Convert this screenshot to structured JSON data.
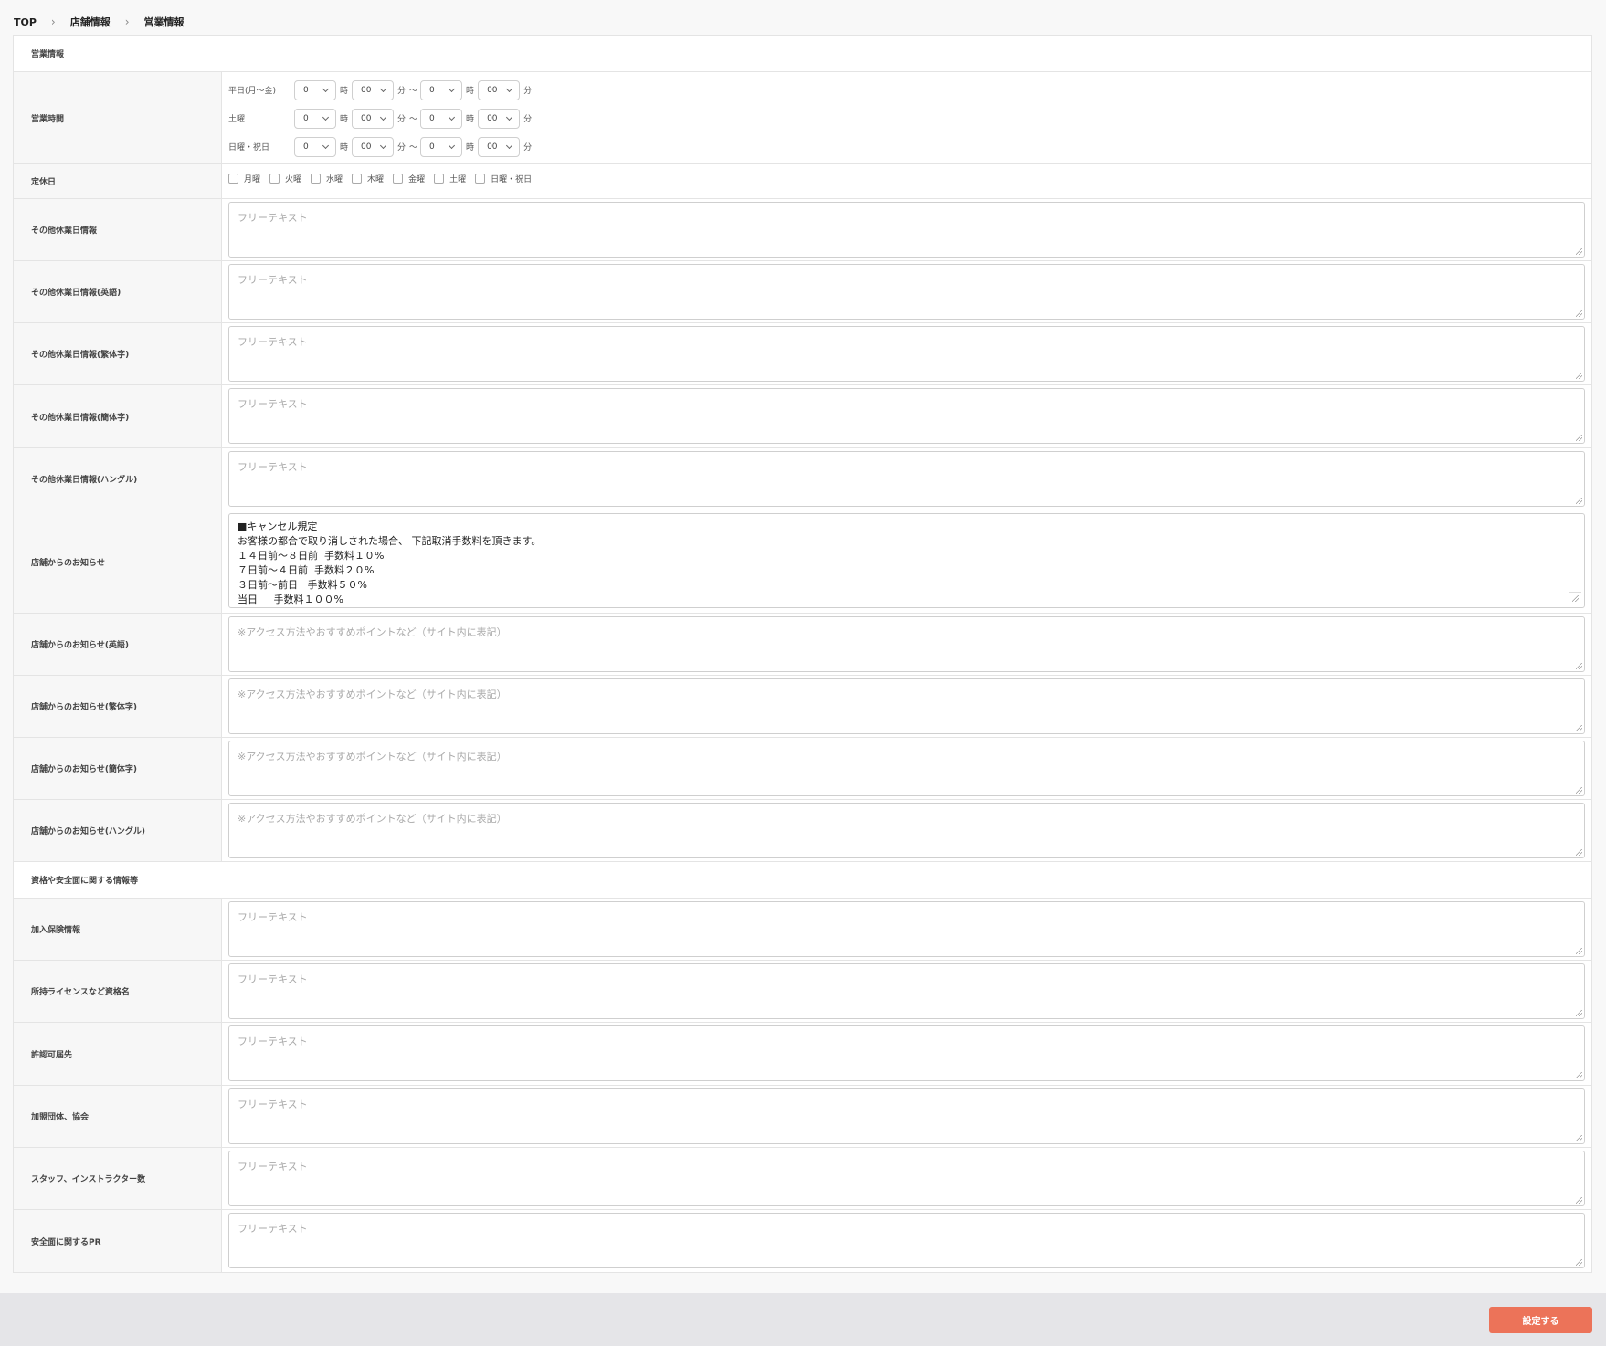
{
  "breadcrumb": [
    "TOP",
    "店舗情報",
    "営業情報"
  ],
  "section1": {
    "title": "営業情報",
    "hours": {
      "label": "営業時間",
      "rows": [
        {
          "day": "平日(月〜金)",
          "sh": "0",
          "sm": "00",
          "eh": "0",
          "em": "00"
        },
        {
          "day": "土曜",
          "sh": "0",
          "sm": "00",
          "eh": "0",
          "em": "00"
        },
        {
          "day": "日曜・祝日",
          "sh": "0",
          "sm": "00",
          "eh": "0",
          "em": "00"
        }
      ],
      "unit_hour": "時",
      "unit_min": "分",
      "tilde": "〜"
    },
    "holidays": {
      "label": "定休日",
      "options": [
        "月曜",
        "火曜",
        "水曜",
        "木曜",
        "金曜",
        "土曜",
        "日曜・祝日"
      ]
    },
    "text_fields": [
      {
        "label": "その他休業日情報",
        "placeholder": "フリーテキスト"
      },
      {
        "label": "その他休業日情報(英語)",
        "placeholder": "フリーテキスト"
      },
      {
        "label": "その他休業日情報(繁体字)",
        "placeholder": "フリーテキスト"
      },
      {
        "label": "その他休業日情報(簡体字)",
        "placeholder": "フリーテキスト"
      },
      {
        "label": "その他休業日情報(ハングル)",
        "placeholder": "フリーテキスト"
      }
    ],
    "notice": {
      "label": "店舗からのお知らせ",
      "lines": [
        "■キャンセル規定",
        "お客様の都合で取り消しされた場合、 下記取消手数料を頂きます。",
        "１４日前〜８日前  手数料１０%",
        "７日前〜４日前  手数料２０%",
        "３日前〜前日   手数料５０%",
        "当日     手数料１００%"
      ]
    },
    "notice_fields": [
      {
        "label": "店舗からのお知らせ(英語)",
        "placeholder": "※アクセス方法やおすすめポイントなど（サイト内に表記）"
      },
      {
        "label": "店舗からのお知らせ(繁体字)",
        "placeholder": "※アクセス方法やおすすめポイントなど（サイト内に表記）"
      },
      {
        "label": "店舗からのお知らせ(簡体字)",
        "placeholder": "※アクセス方法やおすすめポイントなど（サイト内に表記）"
      },
      {
        "label": "店舗からのお知らせ(ハングル)",
        "placeholder": "※アクセス方法やおすすめポイントなど（サイト内に表記）"
      }
    ]
  },
  "section2": {
    "title": "資格や安全面に関する情報等",
    "fields": [
      {
        "label": "加入保険情報",
        "placeholder": "フリーテキスト"
      },
      {
        "label": "所持ライセンスなど資格名",
        "placeholder": "フリーテキスト"
      },
      {
        "label": "許認可届先",
        "placeholder": "フリーテキスト"
      },
      {
        "label": "加盟団体、協会",
        "placeholder": "フリーテキスト"
      },
      {
        "label": "スタッフ、インストラクター数",
        "placeholder": "フリーテキスト"
      },
      {
        "label": "安全面に関するPR",
        "placeholder": "フリーテキスト"
      }
    ]
  },
  "submit_label": "設定する",
  "colors": {
    "accent": "#ec7359",
    "label_bg": "#f7f7f7",
    "footer_bg": "#e5e5e8"
  }
}
